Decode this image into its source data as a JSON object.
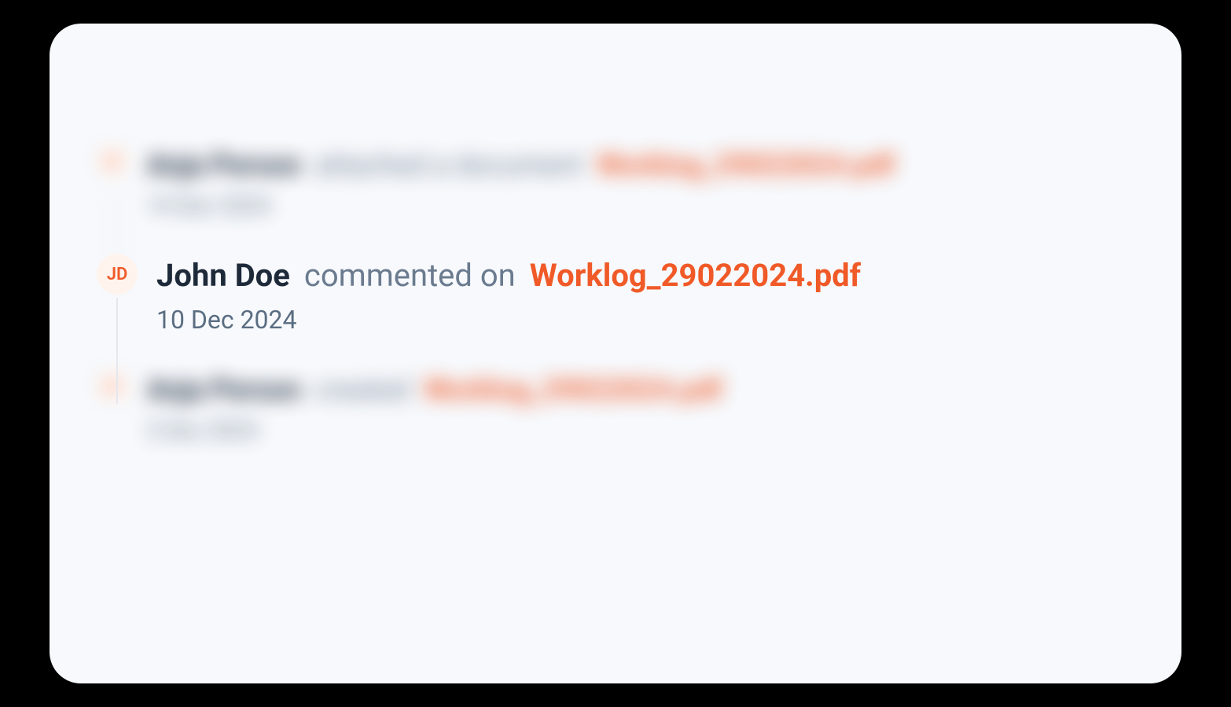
{
  "activities": [
    {
      "avatar_initials": "AP",
      "person": "Anja Person",
      "action": "attached a document",
      "file": "Worklog_29022024.pdf",
      "date": "14 Dec 2024",
      "focused": false
    },
    {
      "avatar_initials": "JD",
      "person": "John Doe",
      "action": "commented on",
      "file": "Worklog_29022024.pdf",
      "date": "10 Dec 2024",
      "focused": true
    },
    {
      "avatar_initials": "AP",
      "person": "Anja Person",
      "action": "created",
      "file": "Worklog_29022024.pdf",
      "date": "2 Dec 2024",
      "focused": false
    }
  ],
  "colors": {
    "accent": "#f05a28",
    "background": "#f7f9fc",
    "text_primary": "#1e2a3a",
    "text_secondary": "#6b7b8f",
    "avatar_bg": "#fff4ed"
  }
}
